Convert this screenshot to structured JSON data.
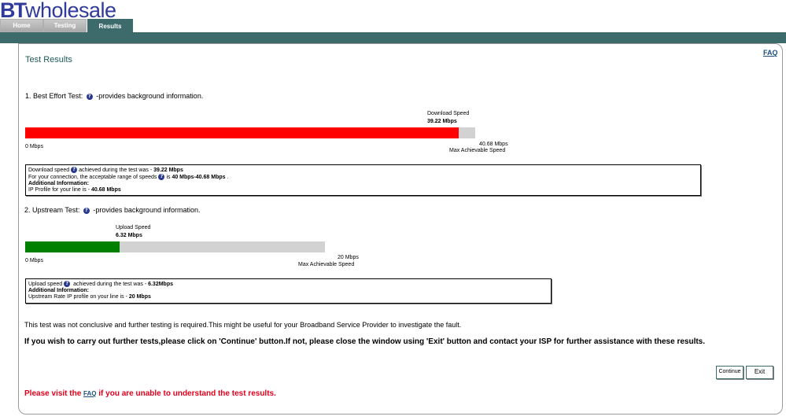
{
  "logo": {
    "bt": "BT",
    "wholesale": "wholesale"
  },
  "tabs": [
    {
      "label": "Home"
    },
    {
      "label": "Testing"
    },
    {
      "label": "Results"
    }
  ],
  "header": {
    "faq": "FAQ",
    "title": "Test Results"
  },
  "best_effort": {
    "heading_prefix": "1. Best Effort Test:",
    "heading_suffix": "-provides background information.",
    "speed_label": "Download Speed",
    "speed_value": "39.22 Mbps",
    "min_label": "0 Mbps",
    "max_value": "40.68 Mbps",
    "max_label": "Max Achievable Speed",
    "fill_fraction": 0.964,
    "fill_color": "#ff0000",
    "info": {
      "line1_prefix": "Download speed",
      "line1_mid": "achieved during the test was - ",
      "line1_value": "39.22 Mbps",
      "line2_prefix": "For your connection, the acceptable range of speeds",
      "line2_mid": "is ",
      "line2_value": "40 Mbps-40.68 Mbps",
      "line2_end": " .",
      "additional": "Additional Information:",
      "line3_prefix": "IP Profile for your line is - ",
      "line3_value": "40.68 Mbps"
    }
  },
  "upstream": {
    "heading_prefix": "2. Upstream Test:",
    "heading_suffix": "-provides background information.",
    "speed_label": "Upload Speed",
    "speed_value": "6.32 Mbps",
    "min_label": "0 Mbps",
    "max_value": "20 Mbps",
    "max_label": "Max Achievable Speed",
    "fill_fraction": 0.316,
    "fill_color": "#008000",
    "info": {
      "line1_prefix": "Upload speed",
      "line1_mid": " achieved during the test was - ",
      "line1_value": "6.32Mbps",
      "additional": "Additional Information:",
      "line2_prefix": "Upstream Rate IP profile on your line is - ",
      "line2_value": "20 Mbps"
    }
  },
  "message": "This test was not conclusive and further testing is required.This might be useful for your Broadband Service Provider to investigate the fault.",
  "instructions": "If you wish to carry out further tests,please click on 'Continue' button.If not, please close the window using 'Exit' button and contact your ISP for further assistance with these results.",
  "buttons": {
    "continue": "Continue",
    "exit": "Exit"
  },
  "footer": {
    "prefix": "Please visit the ",
    "faq": "FAQ",
    "suffix": " if you are unable to understand the test results."
  },
  "colors": {
    "brand_teal": "#3d6b6b",
    "logo_blue": "#2f3a9a",
    "alert_red": "#e0001b"
  }
}
